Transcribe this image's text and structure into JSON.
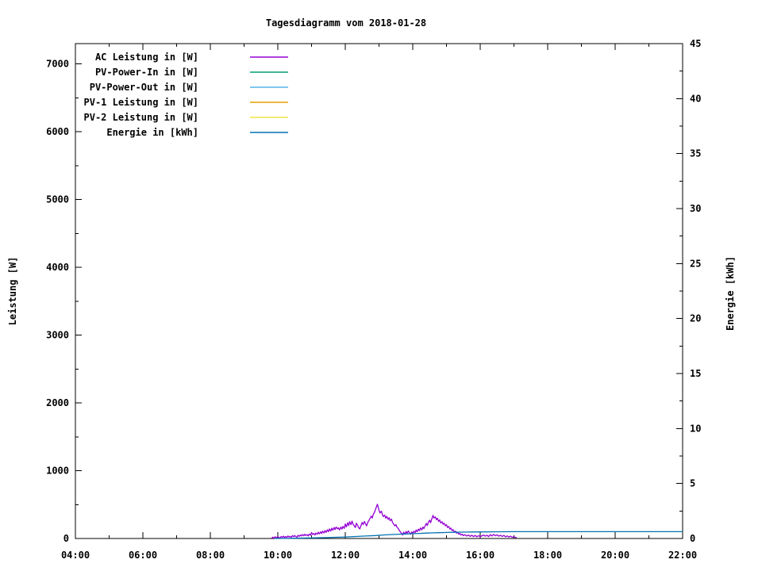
{
  "window": {
    "title": "Tagesdiagramm vom 2018-01-28"
  },
  "colors": {
    "background": "#ffffff",
    "axis": "#000000",
    "text": "#000000",
    "ac": "#9400d3",
    "pv_power_in": "#009e73",
    "pv_power_out": "#56b4e9",
    "pv1": "#e69f00",
    "pv2": "#f0e442",
    "energie": "#0072b2"
  },
  "chart_data": {
    "type": "line",
    "title": "Tagesdiagramm vom 2018-01-28",
    "grid": false,
    "legend_position": "top-left-inside",
    "x_axis": {
      "label": "",
      "range_hours": [
        4,
        22
      ],
      "major_tick_labels": [
        {
          "h": 4,
          "label": "04:00"
        },
        {
          "h": 6,
          "label": "06:00"
        },
        {
          "h": 8,
          "label": "08:00"
        },
        {
          "h": 10,
          "label": "10:00"
        },
        {
          "h": 12,
          "label": "12:00"
        },
        {
          "h": 14,
          "label": "14:00"
        },
        {
          "h": 16,
          "label": "16:00"
        },
        {
          "h": 18,
          "label": "18:00"
        },
        {
          "h": 20,
          "label": "20:00"
        },
        {
          "h": 22,
          "label": "22:00"
        }
      ],
      "minor_step_hours": 1
    },
    "y_left": {
      "label": "Leistung [W]",
      "range": [
        0,
        7300
      ],
      "major_step": 1000,
      "minor_step": 500,
      "max_labeled": 7000
    },
    "y_right": {
      "label": "Energie [kWh]",
      "range": [
        0,
        45
      ],
      "major_step": 5,
      "minor_step": 2.5
    },
    "series": [
      {
        "name": "AC Leistung in [W]",
        "color": "#9400d3",
        "axis": "left",
        "points": [
          [
            9.82,
            2
          ],
          [
            9.85,
            20
          ],
          [
            9.88,
            6
          ],
          [
            9.92,
            24
          ],
          [
            9.95,
            10
          ],
          [
            10.0,
            28
          ],
          [
            10.03,
            14
          ],
          [
            10.07,
            8
          ],
          [
            10.1,
            30
          ],
          [
            10.13,
            16
          ],
          [
            10.17,
            34
          ],
          [
            10.2,
            12
          ],
          [
            10.23,
            28
          ],
          [
            10.27,
            18
          ],
          [
            10.3,
            38
          ],
          [
            10.33,
            22
          ],
          [
            10.37,
            30
          ],
          [
            10.4,
            16
          ],
          [
            10.43,
            42
          ],
          [
            10.47,
            26
          ],
          [
            10.5,
            44
          ],
          [
            10.53,
            30
          ],
          [
            10.57,
            20
          ],
          [
            10.6,
            48
          ],
          [
            10.63,
            32
          ],
          [
            10.67,
            52
          ],
          [
            10.7,
            36
          ],
          [
            10.73,
            58
          ],
          [
            10.77,
            40
          ],
          [
            10.8,
            62
          ],
          [
            10.83,
            44
          ],
          [
            10.87,
            56
          ],
          [
            10.9,
            38
          ],
          [
            10.93,
            66
          ],
          [
            10.97,
            48
          ],
          [
            11.0,
            88
          ],
          [
            11.03,
            60
          ],
          [
            11.07,
            74
          ],
          [
            11.1,
            52
          ],
          [
            11.13,
            80
          ],
          [
            11.17,
            62
          ],
          [
            11.2,
            92
          ],
          [
            11.23,
            68
          ],
          [
            11.27,
            98
          ],
          [
            11.3,
            72
          ],
          [
            11.33,
            108
          ],
          [
            11.37,
            82
          ],
          [
            11.4,
            118
          ],
          [
            11.43,
            90
          ],
          [
            11.47,
            128
          ],
          [
            11.5,
            100
          ],
          [
            11.53,
            140
          ],
          [
            11.57,
            110
          ],
          [
            11.6,
            152
          ],
          [
            11.63,
            122
          ],
          [
            11.67,
            162
          ],
          [
            11.7,
            132
          ],
          [
            11.73,
            170
          ],
          [
            11.77,
            142
          ],
          [
            11.8,
            158
          ],
          [
            11.83,
            126
          ],
          [
            11.87,
            168
          ],
          [
            11.9,
            138
          ],
          [
            11.93,
            178
          ],
          [
            11.97,
            150
          ],
          [
            12.0,
            214
          ],
          [
            12.03,
            170
          ],
          [
            12.07,
            232
          ],
          [
            12.1,
            188
          ],
          [
            12.13,
            248
          ],
          [
            12.17,
            204
          ],
          [
            12.2,
            256
          ],
          [
            12.23,
            212
          ],
          [
            12.27,
            184
          ],
          [
            12.3,
            162
          ],
          [
            12.33,
            226
          ],
          [
            12.37,
            190
          ],
          [
            12.4,
            158
          ],
          [
            12.43,
            142
          ],
          [
            12.47,
            198
          ],
          [
            12.5,
            236
          ],
          [
            12.53,
            206
          ],
          [
            12.57,
            252
          ],
          [
            12.6,
            218
          ],
          [
            12.63,
            186
          ],
          [
            12.67,
            242
          ],
          [
            12.7,
            262
          ],
          [
            12.73,
            292
          ],
          [
            12.77,
            330
          ],
          [
            12.8,
            302
          ],
          [
            12.83,
            356
          ],
          [
            12.87,
            392
          ],
          [
            12.9,
            438
          ],
          [
            12.93,
            474
          ],
          [
            12.95,
            505
          ],
          [
            12.98,
            452
          ],
          [
            13.0,
            414
          ],
          [
            13.03,
            376
          ],
          [
            13.07,
            404
          ],
          [
            13.1,
            352
          ],
          [
            13.13,
            322
          ],
          [
            13.17,
            346
          ],
          [
            13.2,
            300
          ],
          [
            13.23,
            326
          ],
          [
            13.27,
            282
          ],
          [
            13.3,
            306
          ],
          [
            13.33,
            262
          ],
          [
            13.37,
            286
          ],
          [
            13.4,
            238
          ],
          [
            13.43,
            214
          ],
          [
            13.47,
            186
          ],
          [
            13.5,
            206
          ],
          [
            13.53,
            170
          ],
          [
            13.57,
            146
          ],
          [
            13.6,
            122
          ],
          [
            13.63,
            98
          ],
          [
            13.67,
            74
          ],
          [
            13.7,
            50
          ],
          [
            13.73,
            92
          ],
          [
            13.77,
            66
          ],
          [
            13.8,
            104
          ],
          [
            13.83,
            78
          ],
          [
            13.87,
            112
          ],
          [
            13.9,
            84
          ],
          [
            13.93,
            62
          ],
          [
            13.97,
            96
          ],
          [
            14.0,
            70
          ],
          [
            14.03,
            108
          ],
          [
            14.07,
            86
          ],
          [
            14.1,
            126
          ],
          [
            14.13,
            100
          ],
          [
            14.17,
            138
          ],
          [
            14.2,
            114
          ],
          [
            14.23,
            156
          ],
          [
            14.27,
            128
          ],
          [
            14.3,
            168
          ],
          [
            14.33,
            146
          ],
          [
            14.37,
            188
          ],
          [
            14.4,
            224
          ],
          [
            14.43,
            192
          ],
          [
            14.47,
            246
          ],
          [
            14.5,
            270
          ],
          [
            14.53,
            232
          ],
          [
            14.57,
            296
          ],
          [
            14.6,
            340
          ],
          [
            14.63,
            302
          ],
          [
            14.67,
            318
          ],
          [
            14.7,
            276
          ],
          [
            14.73,
            298
          ],
          [
            14.77,
            252
          ],
          [
            14.8,
            274
          ],
          [
            14.83,
            228
          ],
          [
            14.87,
            248
          ],
          [
            14.9,
            208
          ],
          [
            14.93,
            226
          ],
          [
            14.97,
            186
          ],
          [
            15.0,
            204
          ],
          [
            15.03,
            162
          ],
          [
            15.07,
            178
          ],
          [
            15.1,
            138
          ],
          [
            15.13,
            152
          ],
          [
            15.17,
            116
          ],
          [
            15.2,
            130
          ],
          [
            15.23,
            96
          ],
          [
            15.27,
            108
          ],
          [
            15.3,
            78
          ],
          [
            15.33,
            90
          ],
          [
            15.37,
            62
          ],
          [
            15.4,
            74
          ],
          [
            15.43,
            50
          ],
          [
            15.47,
            62
          ],
          [
            15.5,
            42
          ],
          [
            15.55,
            56
          ],
          [
            15.6,
            36
          ],
          [
            15.65,
            52
          ],
          [
            15.7,
            32
          ],
          [
            15.75,
            48
          ],
          [
            15.8,
            28
          ],
          [
            15.85,
            44
          ],
          [
            15.9,
            26
          ],
          [
            15.95,
            42
          ],
          [
            16.0,
            24
          ],
          [
            16.05,
            40
          ],
          [
            16.1,
            52
          ],
          [
            16.15,
            34
          ],
          [
            16.2,
            48
          ],
          [
            16.25,
            28
          ],
          [
            16.3,
            56
          ],
          [
            16.35,
            38
          ],
          [
            16.4,
            60
          ],
          [
            16.45,
            40
          ],
          [
            16.5,
            54
          ],
          [
            16.55,
            34
          ],
          [
            16.6,
            48
          ],
          [
            16.65,
            30
          ],
          [
            16.7,
            44
          ],
          [
            16.75,
            26
          ],
          [
            16.8,
            38
          ],
          [
            16.85,
            22
          ],
          [
            16.9,
            34
          ],
          [
            16.95,
            18
          ],
          [
            17.0,
            26
          ],
          [
            17.05,
            14
          ],
          [
            17.08,
            12
          ]
        ]
      },
      {
        "name": "PV-Power-In in [W]",
        "color": "#009e73",
        "axis": "left",
        "points": []
      },
      {
        "name": "PV-Power-Out in [W]",
        "color": "#56b4e9",
        "axis": "left",
        "points": []
      },
      {
        "name": "PV-1 Leistung in [W]",
        "color": "#e69f00",
        "axis": "left",
        "points": []
      },
      {
        "name": "PV-2 Leistung in [W]",
        "color": "#f0e442",
        "axis": "left",
        "points": []
      },
      {
        "name": "Energie in [kWh]",
        "color": "#0072b2",
        "axis": "right",
        "points": [
          [
            9.9,
            0
          ],
          [
            10.2,
            0.01
          ],
          [
            10.5,
            0.02
          ],
          [
            10.8,
            0.04
          ],
          [
            11.1,
            0.06
          ],
          [
            11.4,
            0.08
          ],
          [
            11.7,
            0.11
          ],
          [
            12.0,
            0.14
          ],
          [
            12.3,
            0.18
          ],
          [
            12.6,
            0.22
          ],
          [
            12.9,
            0.27
          ],
          [
            13.0,
            0.29
          ],
          [
            13.2,
            0.33
          ],
          [
            13.4,
            0.36
          ],
          [
            13.6,
            0.39
          ],
          [
            13.8,
            0.41
          ],
          [
            14.0,
            0.44
          ],
          [
            14.2,
            0.46
          ],
          [
            14.4,
            0.49
          ],
          [
            14.6,
            0.51
          ],
          [
            14.8,
            0.53
          ],
          [
            15.0,
            0.55
          ],
          [
            15.2,
            0.565
          ],
          [
            15.4,
            0.575
          ],
          [
            15.6,
            0.585
          ],
          [
            15.8,
            0.592
          ],
          [
            16.0,
            0.6
          ],
          [
            16.3,
            0.608
          ],
          [
            16.6,
            0.613
          ],
          [
            17.0,
            0.618
          ],
          [
            18.0,
            0.62
          ],
          [
            22.0,
            0.62
          ]
        ]
      }
    ]
  }
}
